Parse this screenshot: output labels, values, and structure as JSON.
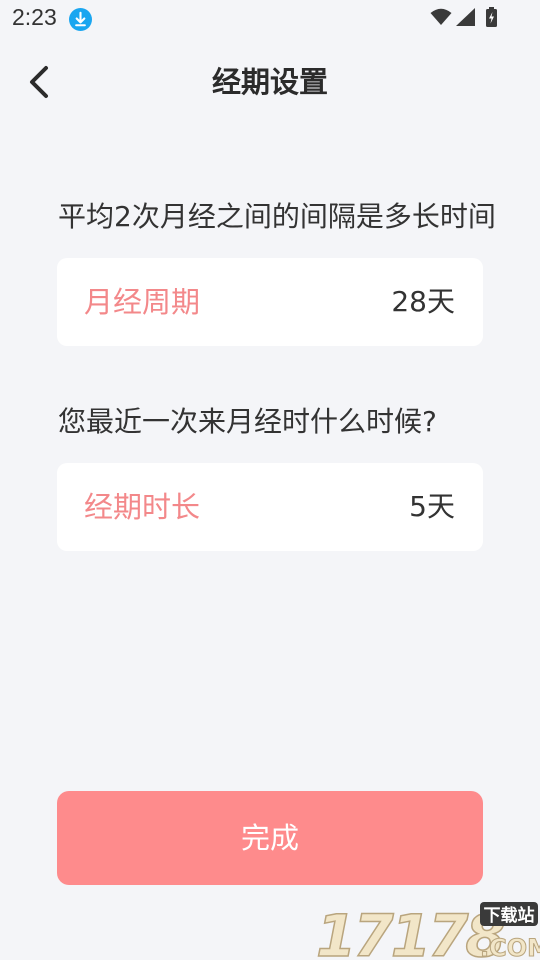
{
  "status_bar": {
    "time": "2:23",
    "icons": [
      "download-icon",
      "wifi-icon",
      "signal-icon",
      "battery-icon"
    ],
    "download_icon_color": "#1aa6f0"
  },
  "header": {
    "title": "经期设置",
    "back_icon": "chevron-left-icon"
  },
  "form": {
    "cycle_question": "平均2次月经之间的间隔是多长时间",
    "cycle_label": "月经周期",
    "cycle_value": "28天",
    "period_question": "您最近一次来月经时什么时候?",
    "period_label": "经期时长",
    "period_value": "5天"
  },
  "done_button": {
    "label": "完成"
  },
  "watermark": {
    "number": "17178",
    "tag": "下载站",
    "suffix": ".COM"
  },
  "colors": {
    "background": "#f4f5f8",
    "accent_text": "#f3888a",
    "button": "#fe8b8c",
    "card": "#ffffff"
  }
}
